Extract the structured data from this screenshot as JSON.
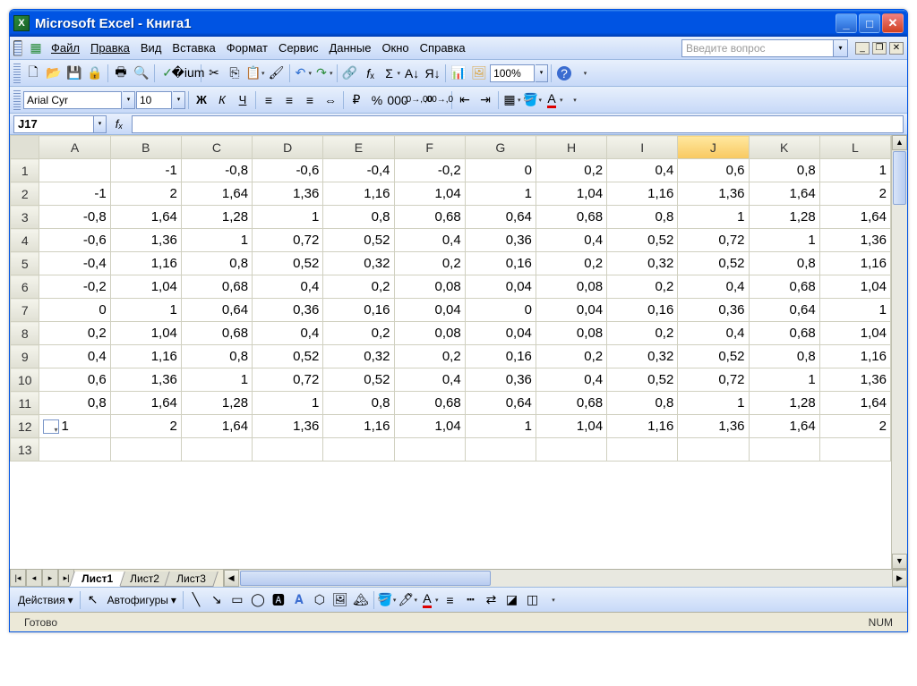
{
  "title": "Microsoft Excel - Книга1",
  "menu": {
    "file": "Файл",
    "edit": "Правка",
    "view": "Вид",
    "insert": "Вставка",
    "format": "Формат",
    "tools": "Сервис",
    "data": "Данные",
    "window": "Окно",
    "help": "Справка"
  },
  "help_placeholder": "Введите вопрос",
  "font": {
    "name": "Arial Cyr",
    "size": "10"
  },
  "zoom": "100%",
  "namebox": "J17",
  "formula": "",
  "columns": [
    "A",
    "B",
    "C",
    "D",
    "E",
    "F",
    "G",
    "H",
    "I",
    "J",
    "K",
    "L"
  ],
  "active_col": "J",
  "rows": [
    [
      "",
      "-1",
      "-0,8",
      "-0,6",
      "-0,4",
      "-0,2",
      "0",
      "0,2",
      "0,4",
      "0,6",
      "0,8",
      "1"
    ],
    [
      "-1",
      "2",
      "1,64",
      "1,36",
      "1,16",
      "1,04",
      "1",
      "1,04",
      "1,16",
      "1,36",
      "1,64",
      "2"
    ],
    [
      "-0,8",
      "1,64",
      "1,28",
      "1",
      "0,8",
      "0,68",
      "0,64",
      "0,68",
      "0,8",
      "1",
      "1,28",
      "1,64"
    ],
    [
      "-0,6",
      "1,36",
      "1",
      "0,72",
      "0,52",
      "0,4",
      "0,36",
      "0,4",
      "0,52",
      "0,72",
      "1",
      "1,36"
    ],
    [
      "-0,4",
      "1,16",
      "0,8",
      "0,52",
      "0,32",
      "0,2",
      "0,16",
      "0,2",
      "0,32",
      "0,52",
      "0,8",
      "1,16"
    ],
    [
      "-0,2",
      "1,04",
      "0,68",
      "0,4",
      "0,2",
      "0,08",
      "0,04",
      "0,08",
      "0,2",
      "0,4",
      "0,68",
      "1,04"
    ],
    [
      "0",
      "1",
      "0,64",
      "0,36",
      "0,16",
      "0,04",
      "0",
      "0,04",
      "0,16",
      "0,36",
      "0,64",
      "1"
    ],
    [
      "0,2",
      "1,04",
      "0,68",
      "0,4",
      "0,2",
      "0,08",
      "0,04",
      "0,08",
      "0,2",
      "0,4",
      "0,68",
      "1,04"
    ],
    [
      "0,4",
      "1,16",
      "0,8",
      "0,52",
      "0,32",
      "0,2",
      "0,16",
      "0,2",
      "0,32",
      "0,52",
      "0,8",
      "1,16"
    ],
    [
      "0,6",
      "1,36",
      "1",
      "0,72",
      "0,52",
      "0,4",
      "0,36",
      "0,4",
      "0,52",
      "0,72",
      "1",
      "1,36"
    ],
    [
      "0,8",
      "1,64",
      "1,28",
      "1",
      "0,8",
      "0,68",
      "0,64",
      "0,68",
      "0,8",
      "1",
      "1,28",
      "1,64"
    ],
    [
      "1",
      "2",
      "1,64",
      "1,36",
      "1,16",
      "1,04",
      "1",
      "1,04",
      "1,16",
      "1,36",
      "1,64",
      "2"
    ],
    [
      "",
      "",
      "",
      "",
      "",
      "",
      "",
      "",
      "",
      "",
      "",
      ""
    ]
  ],
  "smart_tag_row": 12,
  "tabs": {
    "items": [
      "Лист1",
      "Лист2",
      "Лист3"
    ],
    "active": 0
  },
  "drawbar": {
    "actions": "Действия",
    "autoshapes": "Автофигуры"
  },
  "status": {
    "ready": "Готово",
    "num": "NUM"
  }
}
